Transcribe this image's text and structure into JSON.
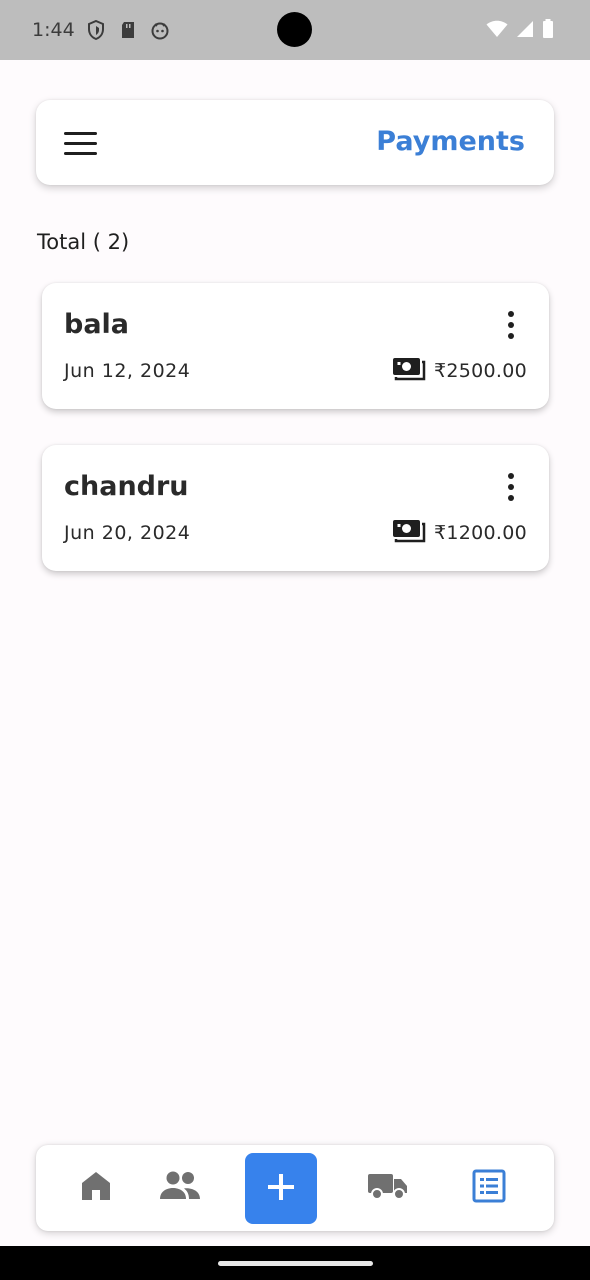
{
  "status_bar": {
    "time": "1:44"
  },
  "app_bar": {
    "title": "Payments"
  },
  "summary": {
    "total_label": "Total ( 2)"
  },
  "payments": [
    {
      "name": "bala",
      "date": "Jun 12, 2024",
      "amount": "₹2500.00"
    },
    {
      "name": "chandru",
      "date": "Jun 20, 2024",
      "amount": "₹1200.00"
    }
  ],
  "bottom_nav": {
    "items": [
      {
        "icon": "home-icon"
      },
      {
        "icon": "people-icon"
      },
      {
        "icon": "add-icon"
      },
      {
        "icon": "truck-icon"
      },
      {
        "icon": "list-icon",
        "active": true
      }
    ]
  },
  "colors": {
    "accent": "#3b7fd6",
    "add_button": "#3782ec",
    "inactive_icon": "#707070",
    "status_bar": "#bdbdbd"
  }
}
